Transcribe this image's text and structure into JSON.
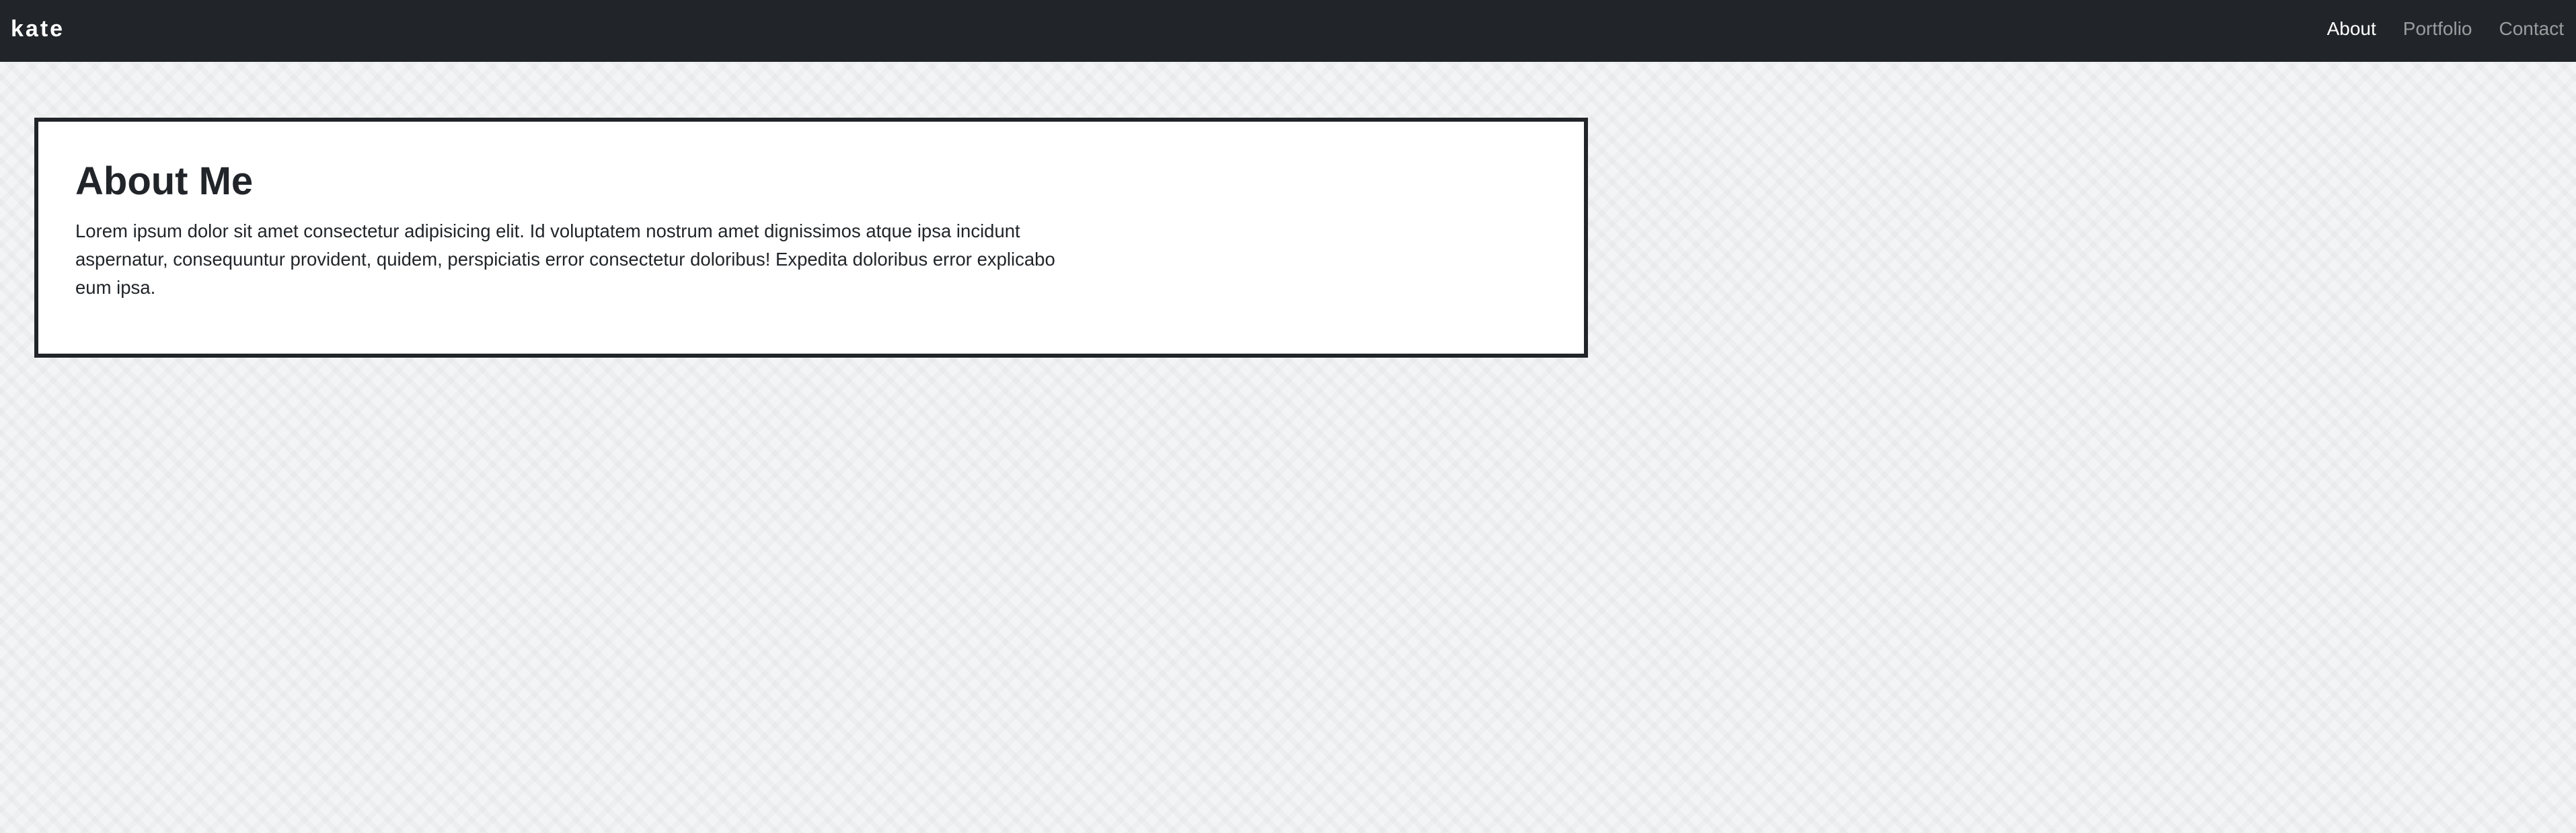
{
  "navbar": {
    "brand": "kate",
    "links": [
      {
        "label": "About",
        "active": true
      },
      {
        "label": "Portfolio",
        "active": false
      },
      {
        "label": "Contact",
        "active": false
      }
    ]
  },
  "about": {
    "title": "About Me",
    "body": "Lorem ipsum dolor sit amet consectetur adipisicing elit. Id voluptatem nostrum amet dignissimos atque ipsa incidunt aspernatur, consequuntur provident, quidem, perspiciatis error consectetur doloribus! Expedita doloribus error explicabo eum ipsa."
  },
  "colors": {
    "navbar_bg": "#212529",
    "nav_active": "#ffffff",
    "nav_inactive": "rgba(255,255,255,0.55)",
    "card_border": "#212529",
    "page_bg": "#f3f4f5"
  }
}
